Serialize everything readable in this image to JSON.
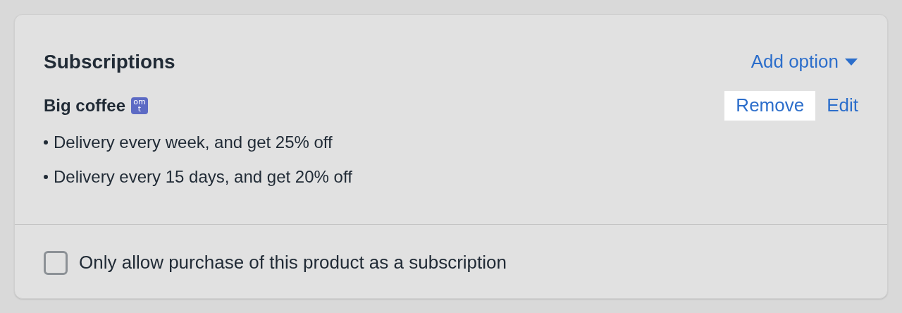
{
  "card": {
    "title": "Subscriptions",
    "add_option": "Add option",
    "plan": {
      "name": "Big coffee",
      "badge_lines": [
        "om",
        "t"
      ],
      "actions": [
        {
          "label": "Remove",
          "highlighted": true
        },
        {
          "label": "Edit",
          "highlighted": false
        }
      ],
      "options": [
        "Delivery every week, and get 25% off",
        "Delivery every 15 days, and get 20% off"
      ]
    },
    "checkbox": {
      "label": "Only allow purchase of this product as a subscription",
      "checked": false
    }
  }
}
